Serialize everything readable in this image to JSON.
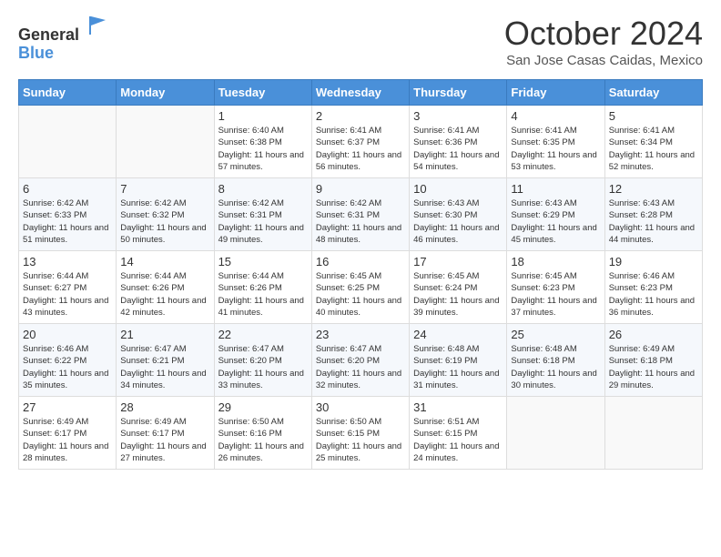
{
  "logo": {
    "general": "General",
    "blue": "Blue"
  },
  "header": {
    "month": "October 2024",
    "location": "San Jose Casas Caidas, Mexico"
  },
  "weekdays": [
    "Sunday",
    "Monday",
    "Tuesday",
    "Wednesday",
    "Thursday",
    "Friday",
    "Saturday"
  ],
  "weeks": [
    [
      {
        "day": "",
        "info": ""
      },
      {
        "day": "",
        "info": ""
      },
      {
        "day": "1",
        "info": "Sunrise: 6:40 AM\nSunset: 6:38 PM\nDaylight: 11 hours and 57 minutes."
      },
      {
        "day": "2",
        "info": "Sunrise: 6:41 AM\nSunset: 6:37 PM\nDaylight: 11 hours and 56 minutes."
      },
      {
        "day": "3",
        "info": "Sunrise: 6:41 AM\nSunset: 6:36 PM\nDaylight: 11 hours and 54 minutes."
      },
      {
        "day": "4",
        "info": "Sunrise: 6:41 AM\nSunset: 6:35 PM\nDaylight: 11 hours and 53 minutes."
      },
      {
        "day": "5",
        "info": "Sunrise: 6:41 AM\nSunset: 6:34 PM\nDaylight: 11 hours and 52 minutes."
      }
    ],
    [
      {
        "day": "6",
        "info": "Sunrise: 6:42 AM\nSunset: 6:33 PM\nDaylight: 11 hours and 51 minutes."
      },
      {
        "day": "7",
        "info": "Sunrise: 6:42 AM\nSunset: 6:32 PM\nDaylight: 11 hours and 50 minutes."
      },
      {
        "day": "8",
        "info": "Sunrise: 6:42 AM\nSunset: 6:31 PM\nDaylight: 11 hours and 49 minutes."
      },
      {
        "day": "9",
        "info": "Sunrise: 6:42 AM\nSunset: 6:31 PM\nDaylight: 11 hours and 48 minutes."
      },
      {
        "day": "10",
        "info": "Sunrise: 6:43 AM\nSunset: 6:30 PM\nDaylight: 11 hours and 46 minutes."
      },
      {
        "day": "11",
        "info": "Sunrise: 6:43 AM\nSunset: 6:29 PM\nDaylight: 11 hours and 45 minutes."
      },
      {
        "day": "12",
        "info": "Sunrise: 6:43 AM\nSunset: 6:28 PM\nDaylight: 11 hours and 44 minutes."
      }
    ],
    [
      {
        "day": "13",
        "info": "Sunrise: 6:44 AM\nSunset: 6:27 PM\nDaylight: 11 hours and 43 minutes."
      },
      {
        "day": "14",
        "info": "Sunrise: 6:44 AM\nSunset: 6:26 PM\nDaylight: 11 hours and 42 minutes."
      },
      {
        "day": "15",
        "info": "Sunrise: 6:44 AM\nSunset: 6:26 PM\nDaylight: 11 hours and 41 minutes."
      },
      {
        "day": "16",
        "info": "Sunrise: 6:45 AM\nSunset: 6:25 PM\nDaylight: 11 hours and 40 minutes."
      },
      {
        "day": "17",
        "info": "Sunrise: 6:45 AM\nSunset: 6:24 PM\nDaylight: 11 hours and 39 minutes."
      },
      {
        "day": "18",
        "info": "Sunrise: 6:45 AM\nSunset: 6:23 PM\nDaylight: 11 hours and 37 minutes."
      },
      {
        "day": "19",
        "info": "Sunrise: 6:46 AM\nSunset: 6:23 PM\nDaylight: 11 hours and 36 minutes."
      }
    ],
    [
      {
        "day": "20",
        "info": "Sunrise: 6:46 AM\nSunset: 6:22 PM\nDaylight: 11 hours and 35 minutes."
      },
      {
        "day": "21",
        "info": "Sunrise: 6:47 AM\nSunset: 6:21 PM\nDaylight: 11 hours and 34 minutes."
      },
      {
        "day": "22",
        "info": "Sunrise: 6:47 AM\nSunset: 6:20 PM\nDaylight: 11 hours and 33 minutes."
      },
      {
        "day": "23",
        "info": "Sunrise: 6:47 AM\nSunset: 6:20 PM\nDaylight: 11 hours and 32 minutes."
      },
      {
        "day": "24",
        "info": "Sunrise: 6:48 AM\nSunset: 6:19 PM\nDaylight: 11 hours and 31 minutes."
      },
      {
        "day": "25",
        "info": "Sunrise: 6:48 AM\nSunset: 6:18 PM\nDaylight: 11 hours and 30 minutes."
      },
      {
        "day": "26",
        "info": "Sunrise: 6:49 AM\nSunset: 6:18 PM\nDaylight: 11 hours and 29 minutes."
      }
    ],
    [
      {
        "day": "27",
        "info": "Sunrise: 6:49 AM\nSunset: 6:17 PM\nDaylight: 11 hours and 28 minutes."
      },
      {
        "day": "28",
        "info": "Sunrise: 6:49 AM\nSunset: 6:17 PM\nDaylight: 11 hours and 27 minutes."
      },
      {
        "day": "29",
        "info": "Sunrise: 6:50 AM\nSunset: 6:16 PM\nDaylight: 11 hours and 26 minutes."
      },
      {
        "day": "30",
        "info": "Sunrise: 6:50 AM\nSunset: 6:15 PM\nDaylight: 11 hours and 25 minutes."
      },
      {
        "day": "31",
        "info": "Sunrise: 6:51 AM\nSunset: 6:15 PM\nDaylight: 11 hours and 24 minutes."
      },
      {
        "day": "",
        "info": ""
      },
      {
        "day": "",
        "info": ""
      }
    ]
  ]
}
